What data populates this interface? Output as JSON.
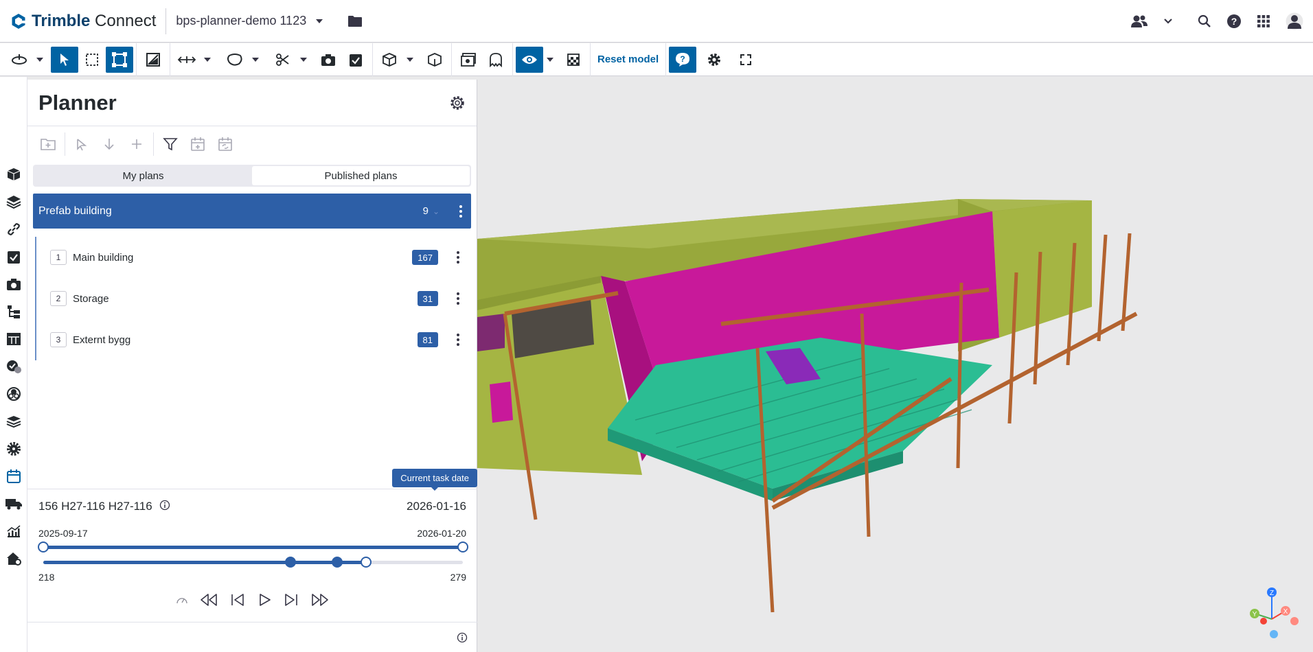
{
  "app": {
    "brand_bold": "Trimble",
    "brand_light": "Connect",
    "project_name": "bps-planner-demo 1123"
  },
  "toolbar": {
    "reset_label": "Reset model"
  },
  "planner": {
    "title": "Planner",
    "tabs": [
      "My plans",
      "Published plans"
    ],
    "selected_tab": "Published plans",
    "group": {
      "name": "Prefab building",
      "count": "9"
    },
    "plans": [
      {
        "index": "1",
        "name": "Main building",
        "count": "167"
      },
      {
        "index": "2",
        "name": "Storage",
        "count": "31"
      },
      {
        "index": "3",
        "name": "Externt bygg",
        "count": "81"
      }
    ],
    "timeline": {
      "tooltip": "Current task date",
      "task_label": "156 H27-116 H27-116",
      "current_date": "2026-01-16",
      "range_start": "2025-09-17",
      "range_end": "2026-01-20",
      "min_index": "218",
      "max_index": "279",
      "date_slider_low": 0.0,
      "date_slider_high": 1.0,
      "index_markers": [
        0.59,
        0.7,
        0.77
      ]
    }
  },
  "colors": {
    "accent": "#2d5fa7",
    "toolbar_active": "#0063a3",
    "wall_green": "#a5b543",
    "wall_magenta": "#c8199a",
    "slab_teal": "#2bbd93",
    "column_brown": "#b3632f"
  }
}
